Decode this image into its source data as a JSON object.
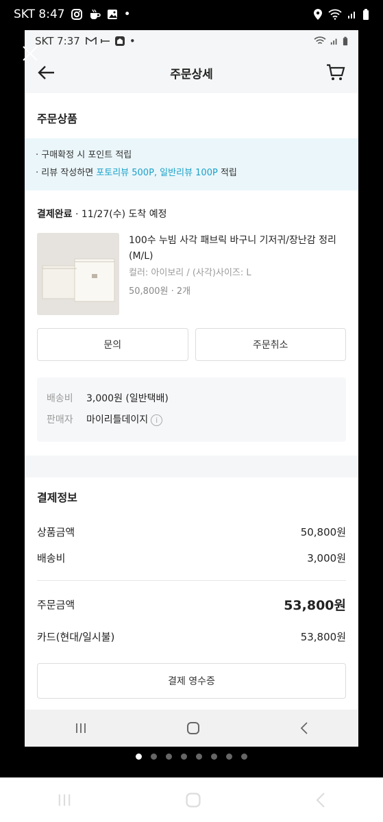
{
  "outer_status": {
    "carrier_time": "SKT 8:47",
    "dot": "•"
  },
  "inner_status": {
    "carrier_time": "SKT 7:37",
    "dot": "•"
  },
  "header": {
    "title": "주문상세"
  },
  "product_section": {
    "title": "주문상품",
    "notice": {
      "line1": "구매확정 시 포인트 적립",
      "line2_prefix": "리뷰 작성하면 ",
      "line2_highlight": "포토리뷰 500P, 일반리뷰 100P",
      "line2_suffix": " 적립",
      "highlight_color": "#1ba0c8"
    },
    "status": "결제완료",
    "status_detail": " · 11/27(수) 도착 예정",
    "product": {
      "name": "100수 누빔 사각 패브릭 바구니 기저귀/장난감 정리 (M/L)",
      "option": "컬러: 아이보리 / (사각)사이즈: L",
      "price_qty": "50,800원 · 2개"
    },
    "buttons": {
      "inquiry": "문의",
      "cancel": "주문취소"
    },
    "shipping": {
      "fee_label": "배송비",
      "fee_value": "3,000원 (일반택배)",
      "seller_label": "판매자",
      "seller_value": "마이리틀데이지"
    }
  },
  "payment": {
    "title": "결제정보",
    "rows": [
      {
        "label": "상품금액",
        "value": "50,800원"
      },
      {
        "label": "배송비",
        "value": "3,000원"
      }
    ],
    "total_label": "주문금액",
    "total_value": "53,800원",
    "method_label": "카드(현대/일시불)",
    "method_value": "53,800원",
    "receipt_button": "결제 영수증"
  },
  "icons": [
    "back-arrow-icon",
    "cart-icon",
    "close-icon",
    "info-icon",
    "recent-apps-icon",
    "home-icon",
    "back-nav-icon"
  ],
  "pager": {
    "count": 8,
    "active": 0
  }
}
